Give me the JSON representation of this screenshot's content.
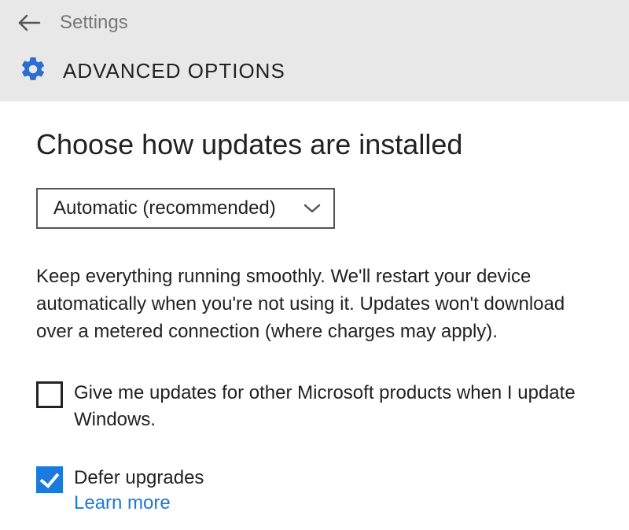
{
  "header": {
    "settings_label": "Settings",
    "page_title": "ADVANCED OPTIONS"
  },
  "main": {
    "section_heading": "Choose how updates are installed",
    "dropdown": {
      "selected": "Automatic (recommended)"
    },
    "description": "Keep everything running smoothly. We'll restart your device automatically when you're not using it. Updates won't download over a metered connection (where charges may apply).",
    "checkbox_other_products": {
      "label": "Give me updates for other Microsoft products when I update Windows.",
      "checked": false
    },
    "checkbox_defer": {
      "label": "Defer upgrades",
      "checked": true,
      "learn_more": "Learn more"
    }
  }
}
